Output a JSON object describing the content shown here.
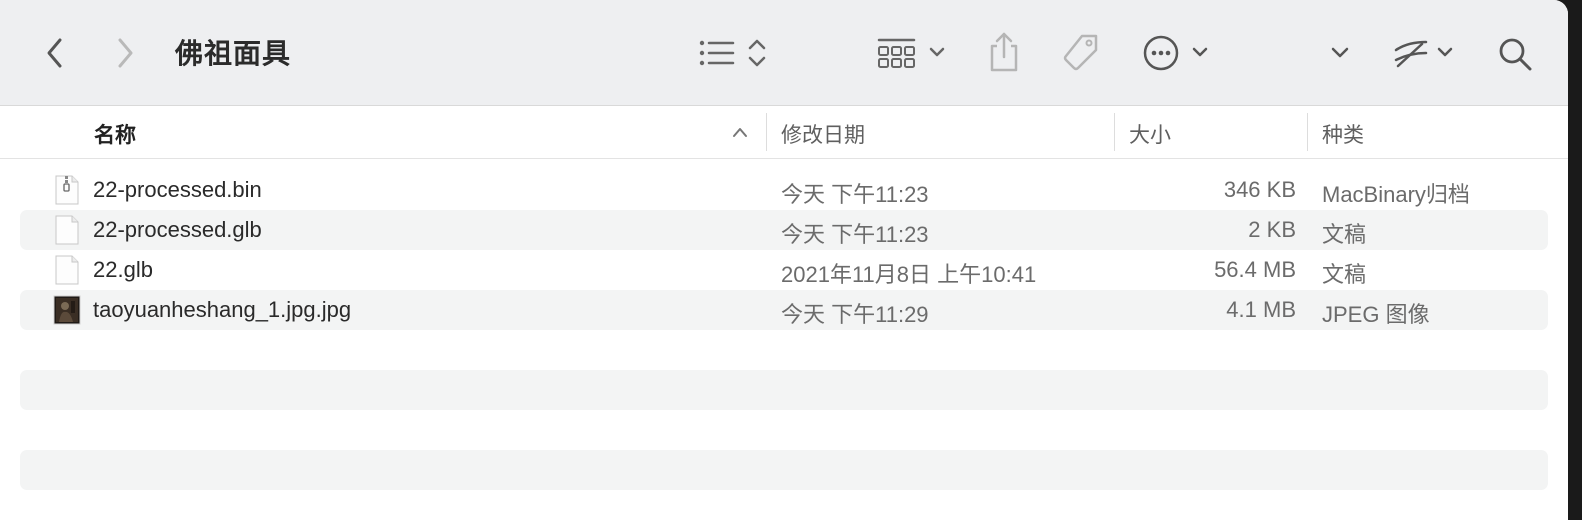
{
  "window": {
    "title": "佛祖面具"
  },
  "toolbar": {
    "back_icon": "chevron-left-icon",
    "forward_icon": "chevron-right-icon",
    "view_list_icon": "list-view-icon",
    "group_icon": "grid-group-icon",
    "share_icon": "share-icon",
    "tag_icon": "tag-icon",
    "more_icon": "ellipsis-circle-icon",
    "search_icon": "search-icon"
  },
  "columns": {
    "name": "名称",
    "date": "修改日期",
    "size": "大小",
    "kind": "种类"
  },
  "files": [
    {
      "name": "22-processed.bin",
      "date": "今天 下午11:23",
      "size": "346 KB",
      "kind": "MacBinary归档",
      "icon": "archive-file-icon"
    },
    {
      "name": "22-processed.glb",
      "date": "今天 下午11:23",
      "size": "2 KB",
      "kind": "文稿",
      "icon": "document-icon"
    },
    {
      "name": "22.glb",
      "date": "2021年11月8日 上午10:41",
      "size": "56.4 MB",
      "kind": "文稿",
      "icon": "document-icon"
    },
    {
      "name": "taoyuanheshang_1.jpg.jpg",
      "date": "今天 下午11:29",
      "size": "4.1 MB",
      "kind": "JPEG 图像",
      "icon": "image-thumbnail-icon"
    }
  ],
  "colors": {
    "toolbar_bg": "#eeeff1",
    "stripe": "#f3f4f4",
    "icon": "#6e6e6e",
    "icon_disabled": "#b5b5b5"
  }
}
